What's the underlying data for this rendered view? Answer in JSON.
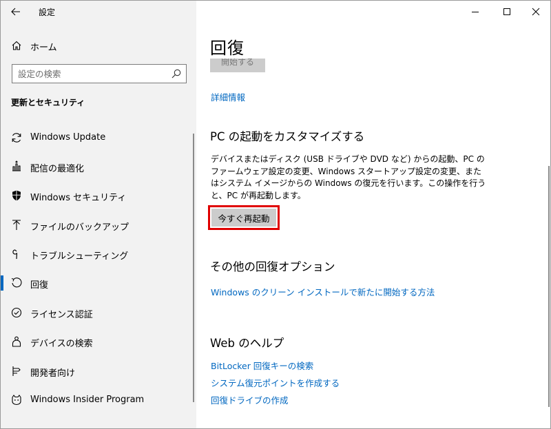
{
  "app": {
    "title": "設定"
  },
  "sidebar": {
    "home_label": "ホーム",
    "search_placeholder": "設定の検索",
    "section_title": "更新とセキュリティ",
    "items": [
      {
        "label": "Windows Update",
        "icon": "refresh-icon"
      },
      {
        "label": "配信の最適化",
        "icon": "delivery-optimization-icon"
      },
      {
        "label": "Windows セキュリティ",
        "icon": "shield-icon"
      },
      {
        "label": "ファイルのバックアップ",
        "icon": "backup-arrow-icon"
      },
      {
        "label": "トラブルシューティング",
        "icon": "wrench-icon"
      },
      {
        "label": "回復",
        "icon": "recovery-icon",
        "selected": true
      },
      {
        "label": "ライセンス認証",
        "icon": "check-circle-icon"
      },
      {
        "label": "デバイスの検索",
        "icon": "person-location-icon"
      },
      {
        "label": "開発者向け",
        "icon": "developer-tools-icon"
      },
      {
        "label": "Windows Insider Program",
        "icon": "insider-cat-icon"
      }
    ]
  },
  "main": {
    "title": "回復",
    "start_button": "開始する",
    "details_link": "詳細情報",
    "advanced_startup": {
      "heading": "PC の起動をカスタマイズする",
      "description": "デバイスまたはディスク (USB ドライブや DVD など) からの起動、PC のファームウェア設定の変更、Windows スタートアップ設定の変更、またはシステム イメージからの Windows の復元を行います。この操作を行うと、PC が再起動します。",
      "restart_button": "今すぐ再起動"
    },
    "more_options": {
      "heading": "その他の回復オプション",
      "link": "Windows のクリーン インストールで新たに開始する方法"
    },
    "web_help": {
      "heading": "Web のヘルプ",
      "links": [
        "BitLocker 回復キーの検索",
        "システム復元ポイントを作成する",
        "回復ドライブの作成"
      ]
    }
  },
  "colors": {
    "accent": "#0067c0",
    "highlight": "#e00000",
    "sidebar_bg": "#f2f2f2"
  }
}
